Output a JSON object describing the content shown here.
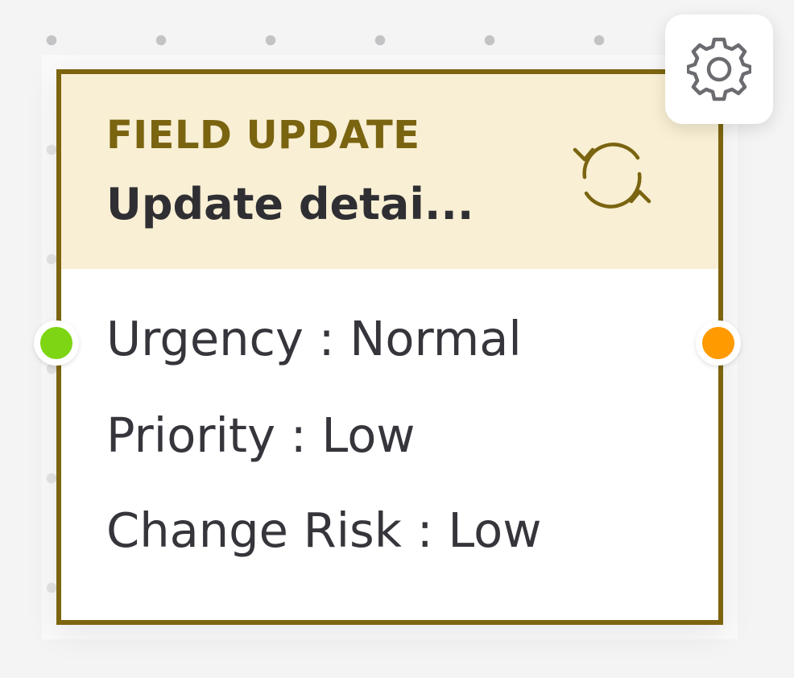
{
  "node": {
    "type_label": "FIELD UPDATE",
    "title": "Update detai...",
    "header_icon": "refresh-icon",
    "fields": [
      "Urgency : Normal",
      "Priority : Low",
      "Change Risk : Low"
    ]
  },
  "ports": {
    "input_color": "#7ed513",
    "output_color": "#ff9a00"
  },
  "settings": {
    "icon": "gear-icon"
  },
  "colors": {
    "border": "#7d6510",
    "header_bg": "#f8efd4",
    "type_label": "#7a6410"
  }
}
